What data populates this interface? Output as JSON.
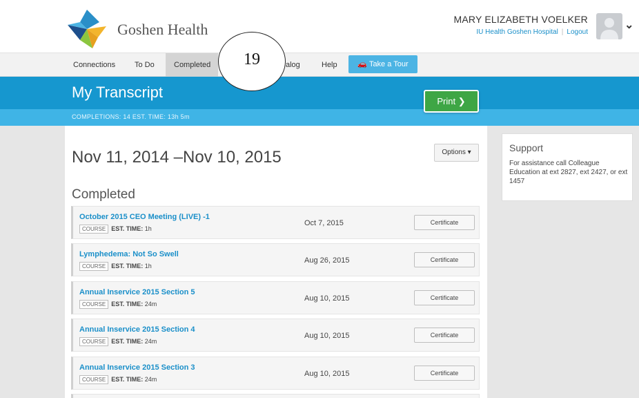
{
  "header": {
    "brand": "Goshen Health",
    "user_name": "MARY ELIZABETH VOELKER",
    "org_link": "IU Health Goshen Hospital",
    "logout": "Logout"
  },
  "nav": {
    "items": [
      {
        "label": "Connections"
      },
      {
        "label": "To Do"
      },
      {
        "label": "Completed"
      },
      {
        "label": "alog"
      },
      {
        "label": "Help"
      }
    ],
    "tour_label": "Take a Tour"
  },
  "callout": {
    "label": "19"
  },
  "title_band": {
    "title": "My Transcript",
    "stats": "COMPLETIONS: 14   EST. TIME: 13h 5m"
  },
  "print_label": "Print ❯",
  "main": {
    "range_title": "Nov 11, 2014 –Nov 10, 2015",
    "options_label": "Options ▾",
    "section_title": "Completed",
    "rows": [
      {
        "title": "October 2015 CEO Meeting (LIVE) -1",
        "type": "COURSE",
        "time_label": "EST. TIME:",
        "time": "1h",
        "date": "Oct 7, 2015",
        "button": "Certificate"
      },
      {
        "title": "Lymphedema: Not So Swell",
        "type": "COURSE",
        "time_label": "EST. TIME:",
        "time": "1h",
        "date": "Aug 26, 2015",
        "button": "Certificate"
      },
      {
        "title": "Annual Inservice 2015 Section 5",
        "type": "COURSE",
        "time_label": "EST. TIME:",
        "time": "24m",
        "date": "Aug 10, 2015",
        "button": "Certificate"
      },
      {
        "title": "Annual Inservice 2015 Section 4",
        "type": "COURSE",
        "time_label": "EST. TIME:",
        "time": "24m",
        "date": "Aug 10, 2015",
        "button": "Certificate"
      },
      {
        "title": "Annual Inservice 2015 Section 3",
        "type": "COURSE",
        "time_label": "EST. TIME:",
        "time": "24m",
        "date": "Aug 10, 2015",
        "button": "Certificate"
      }
    ]
  },
  "support": {
    "title": "Support",
    "text": "For assistance call Colleague Education at ext 2827, ext 2427, or ext 1457"
  },
  "colors": {
    "accent": "#1697cf",
    "print": "#3ea645",
    "link": "#1a8fc9"
  },
  "icons": {
    "logo": "goshen-logo",
    "avatar": "user-avatar-icon",
    "tour": "car-icon",
    "dropdown": "chevron-down-icon"
  }
}
